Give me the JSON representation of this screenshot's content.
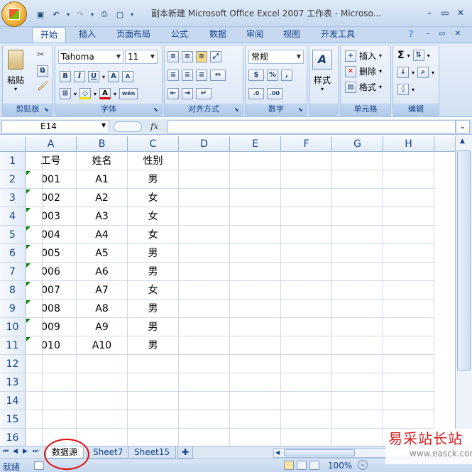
{
  "window": {
    "title": "副本新建 Microsoft Office Excel 2007 工作表 - Microso...",
    "controls": [
      "minimize",
      "maximize",
      "close"
    ]
  },
  "ribbon": {
    "tabs": [
      "开始",
      "插入",
      "页面布局",
      "公式",
      "数据",
      "审阅",
      "视图",
      "开发工具"
    ],
    "active_tab": "开始",
    "groups": {
      "clipboard": {
        "label": "剪贴板",
        "paste": "粘贴"
      },
      "font": {
        "label": "字体",
        "font_name": "Tahoma",
        "font_size": "11",
        "phonetic": "wén"
      },
      "alignment": {
        "label": "对齐方式"
      },
      "number": {
        "label": "数字",
        "format": "常规"
      },
      "styles": {
        "label": "样式"
      },
      "cells": {
        "label": "单元格",
        "insert": "插入",
        "delete": "删除",
        "format": "格式"
      },
      "editing": {
        "label": "编辑"
      }
    }
  },
  "formula_bar": {
    "name_box": "E14",
    "fx": "fx",
    "formula": ""
  },
  "sheet": {
    "columns": [
      "A",
      "B",
      "C",
      "D",
      "E",
      "F",
      "G",
      "H"
    ],
    "rows": [
      "1",
      "2",
      "3",
      "4",
      "5",
      "6",
      "7",
      "8",
      "9",
      "10",
      "11",
      "12",
      "13",
      "14",
      "15",
      "16"
    ],
    "headers": [
      "工号",
      "姓名",
      "性别"
    ],
    "data": [
      [
        "001",
        "A1",
        "男"
      ],
      [
        "002",
        "A2",
        "女"
      ],
      [
        "003",
        "A3",
        "女"
      ],
      [
        "004",
        "A4",
        "女"
      ],
      [
        "005",
        "A5",
        "男"
      ],
      [
        "006",
        "A6",
        "男"
      ],
      [
        "007",
        "A7",
        "女"
      ],
      [
        "008",
        "A8",
        "男"
      ],
      [
        "009",
        "A9",
        "男"
      ],
      [
        "010",
        "A10",
        "男"
      ]
    ]
  },
  "sheet_tabs": {
    "tabs": [
      "数据源",
      "Sheet7",
      "Sheet15"
    ],
    "active": "数据源"
  },
  "status_bar": {
    "ready": "就绪",
    "zoom": "100%"
  },
  "watermark": {
    "text": "易采站长站",
    "url": "www.easck.com"
  },
  "colors": {
    "ribbon_text": "#15428b",
    "annotation_circle": "#e01010",
    "watermark": "#d42020"
  }
}
